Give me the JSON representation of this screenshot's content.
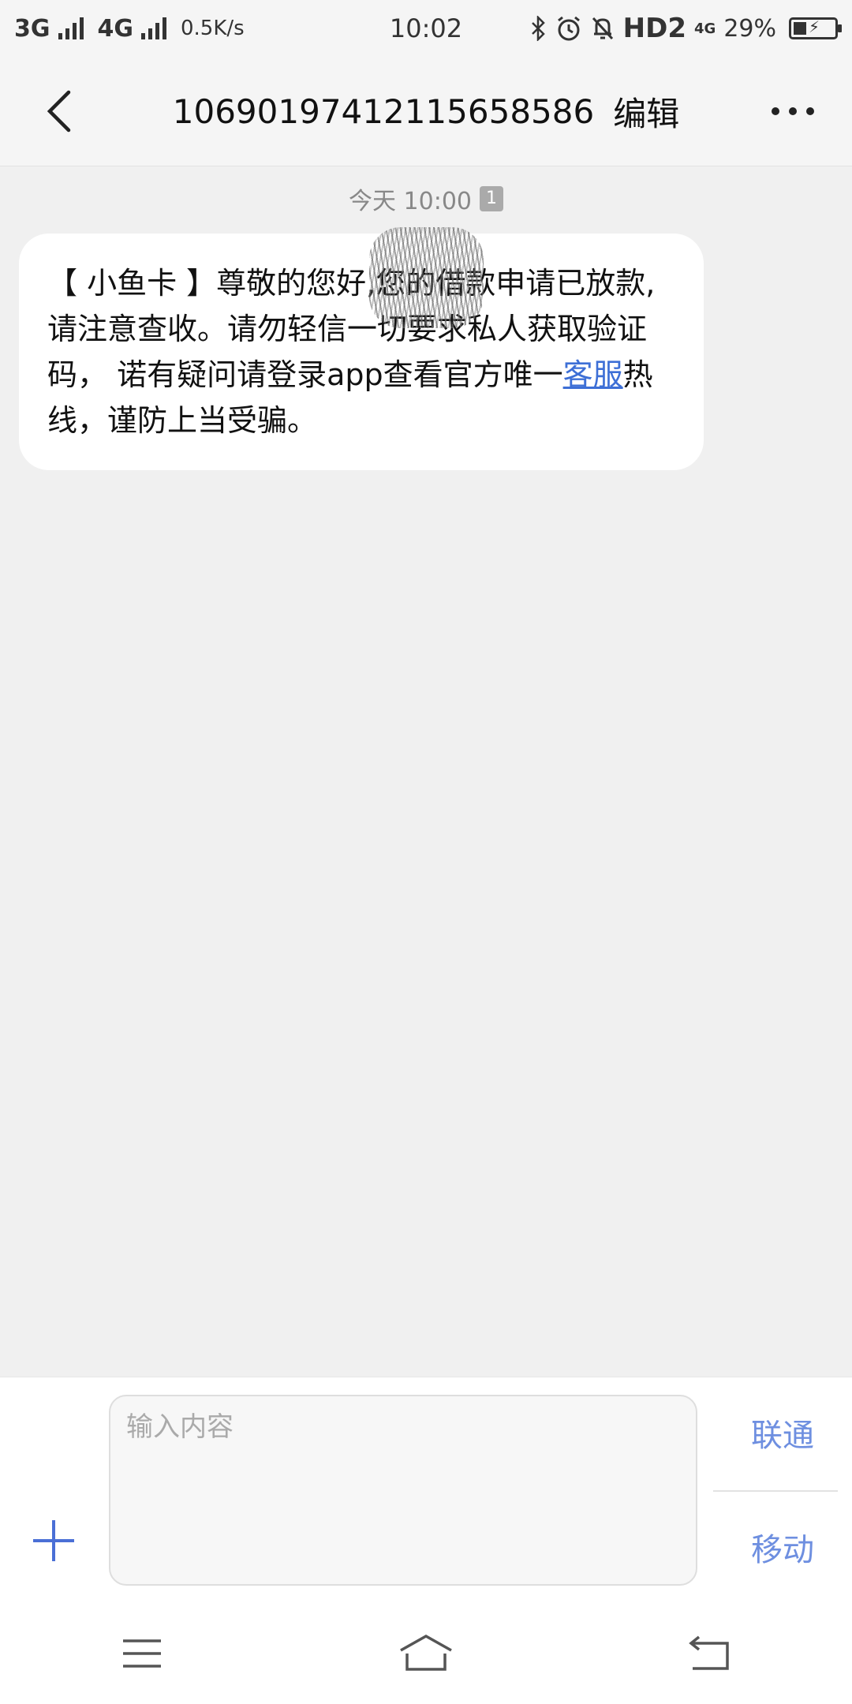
{
  "status_bar": {
    "net1": "3G",
    "net2": "4G",
    "speed": "0.5K/s",
    "time": "10:02",
    "hd": "HD2",
    "net3": "4G",
    "battery": "29%"
  },
  "header": {
    "sender": "106901974121156585​86",
    "edit_label": "编辑"
  },
  "conversation": {
    "timestamp": "今天 10:00",
    "sim_badge": "1",
    "message": {
      "part1": "【 小鱼卡 】尊敬的",
      "part2": "您好,您的借款申请已放款,请注意查收。请勿轻信一切要求私人获取验证码， 诺有疑问请登录app查看官方唯一",
      "link": "客服",
      "part3": "热线，谨防上当受骗。"
    }
  },
  "composer": {
    "placeholder": "输入内容",
    "send_unicom": "联通",
    "send_mobile": "移动"
  },
  "colors": {
    "accent": "#3d6fd6",
    "send": "#6e8fe0",
    "background": "#f0f0f0"
  }
}
